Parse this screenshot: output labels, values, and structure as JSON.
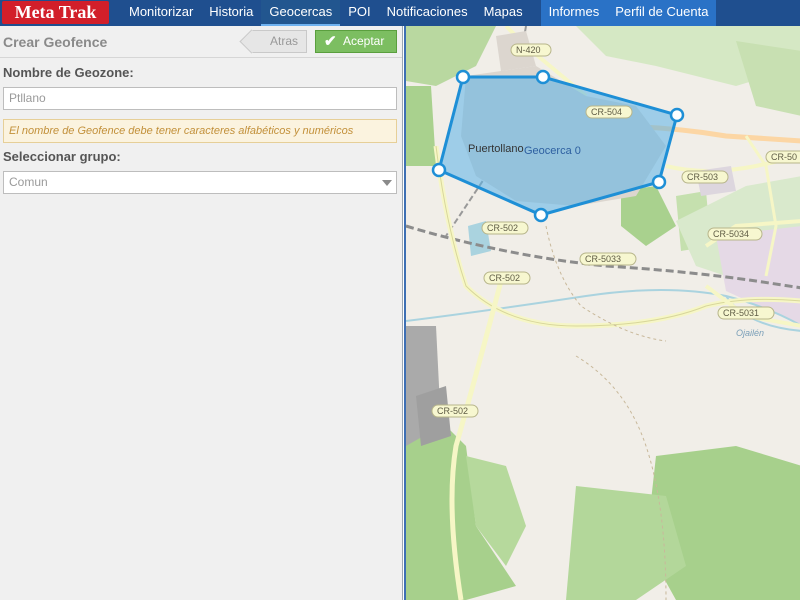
{
  "app": {
    "logo": "Meta Trak"
  },
  "nav": {
    "items": [
      "Monitorizar",
      "Historia",
      "Geocercas",
      "POI",
      "Notificaciones",
      "Mapas"
    ],
    "right_items": [
      "Informes",
      "Perfil de Cuenta"
    ],
    "active": "Geocercas"
  },
  "panel": {
    "title": "Crear Geofence",
    "back_label": "Atras",
    "accept_label": "Aceptar",
    "name_label": "Nombre de Geozone:",
    "name_value": "Ptllano",
    "hint": "El nombre de Geofence debe tener caracteres alfabéticos y numéricos",
    "group_label": "Seleccionar grupo:",
    "group_value": "Comun"
  },
  "map": {
    "geofence_label": "Geocerca 0",
    "place_label": "Puertollano",
    "river_label": "Ojailén",
    "road_labels": [
      "N-420",
      "CR-504",
      "CR-503",
      "CR-502",
      "CR-502",
      "CR-5034",
      "CR-5033",
      "CR-5031",
      "CR-502",
      "CR-50"
    ]
  },
  "colors": {
    "topbar": "#1f4f8f",
    "logo": "#d21f2a",
    "accept": "#7cbe61",
    "geofence": "#1e8fd6"
  }
}
